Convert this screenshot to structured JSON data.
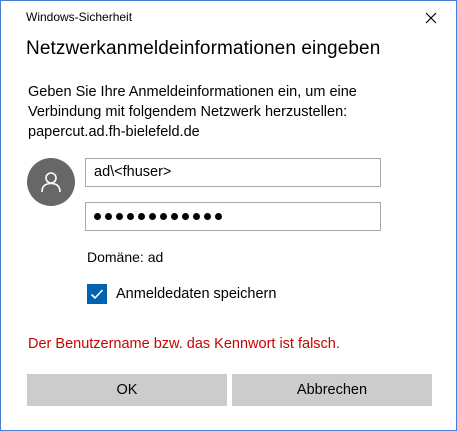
{
  "window": {
    "title": "Windows-Sicherheit",
    "close_icon": "close-icon"
  },
  "dialog": {
    "heading": "Netzwerkanmeldeinformationen eingeben",
    "description_lines": [
      "Geben Sie Ihre Anmeldeinformationen ein, um eine",
      "Verbindung mit folgendem Netzwerk herzustellen:",
      "papercut.ad.fh-bielefeld.de"
    ],
    "avatar_icon": "user-icon",
    "username_value": "ad\\<fhuser>",
    "password_masked_length": 12,
    "domain_text": "Domäne: ad",
    "remember_checkbox": {
      "label": "Anmeldedaten speichern",
      "checked": true
    },
    "error_message": "Der Benutzername bzw. das Kennwort ist falsch.",
    "buttons": {
      "ok_label": "OK",
      "cancel_label": "Abbrechen"
    }
  },
  "colors": {
    "accent": "#0063b1",
    "error": "#c50500",
    "border": "#4a7bd6",
    "button_bg": "#cccccc",
    "avatar_bg": "#676767"
  }
}
